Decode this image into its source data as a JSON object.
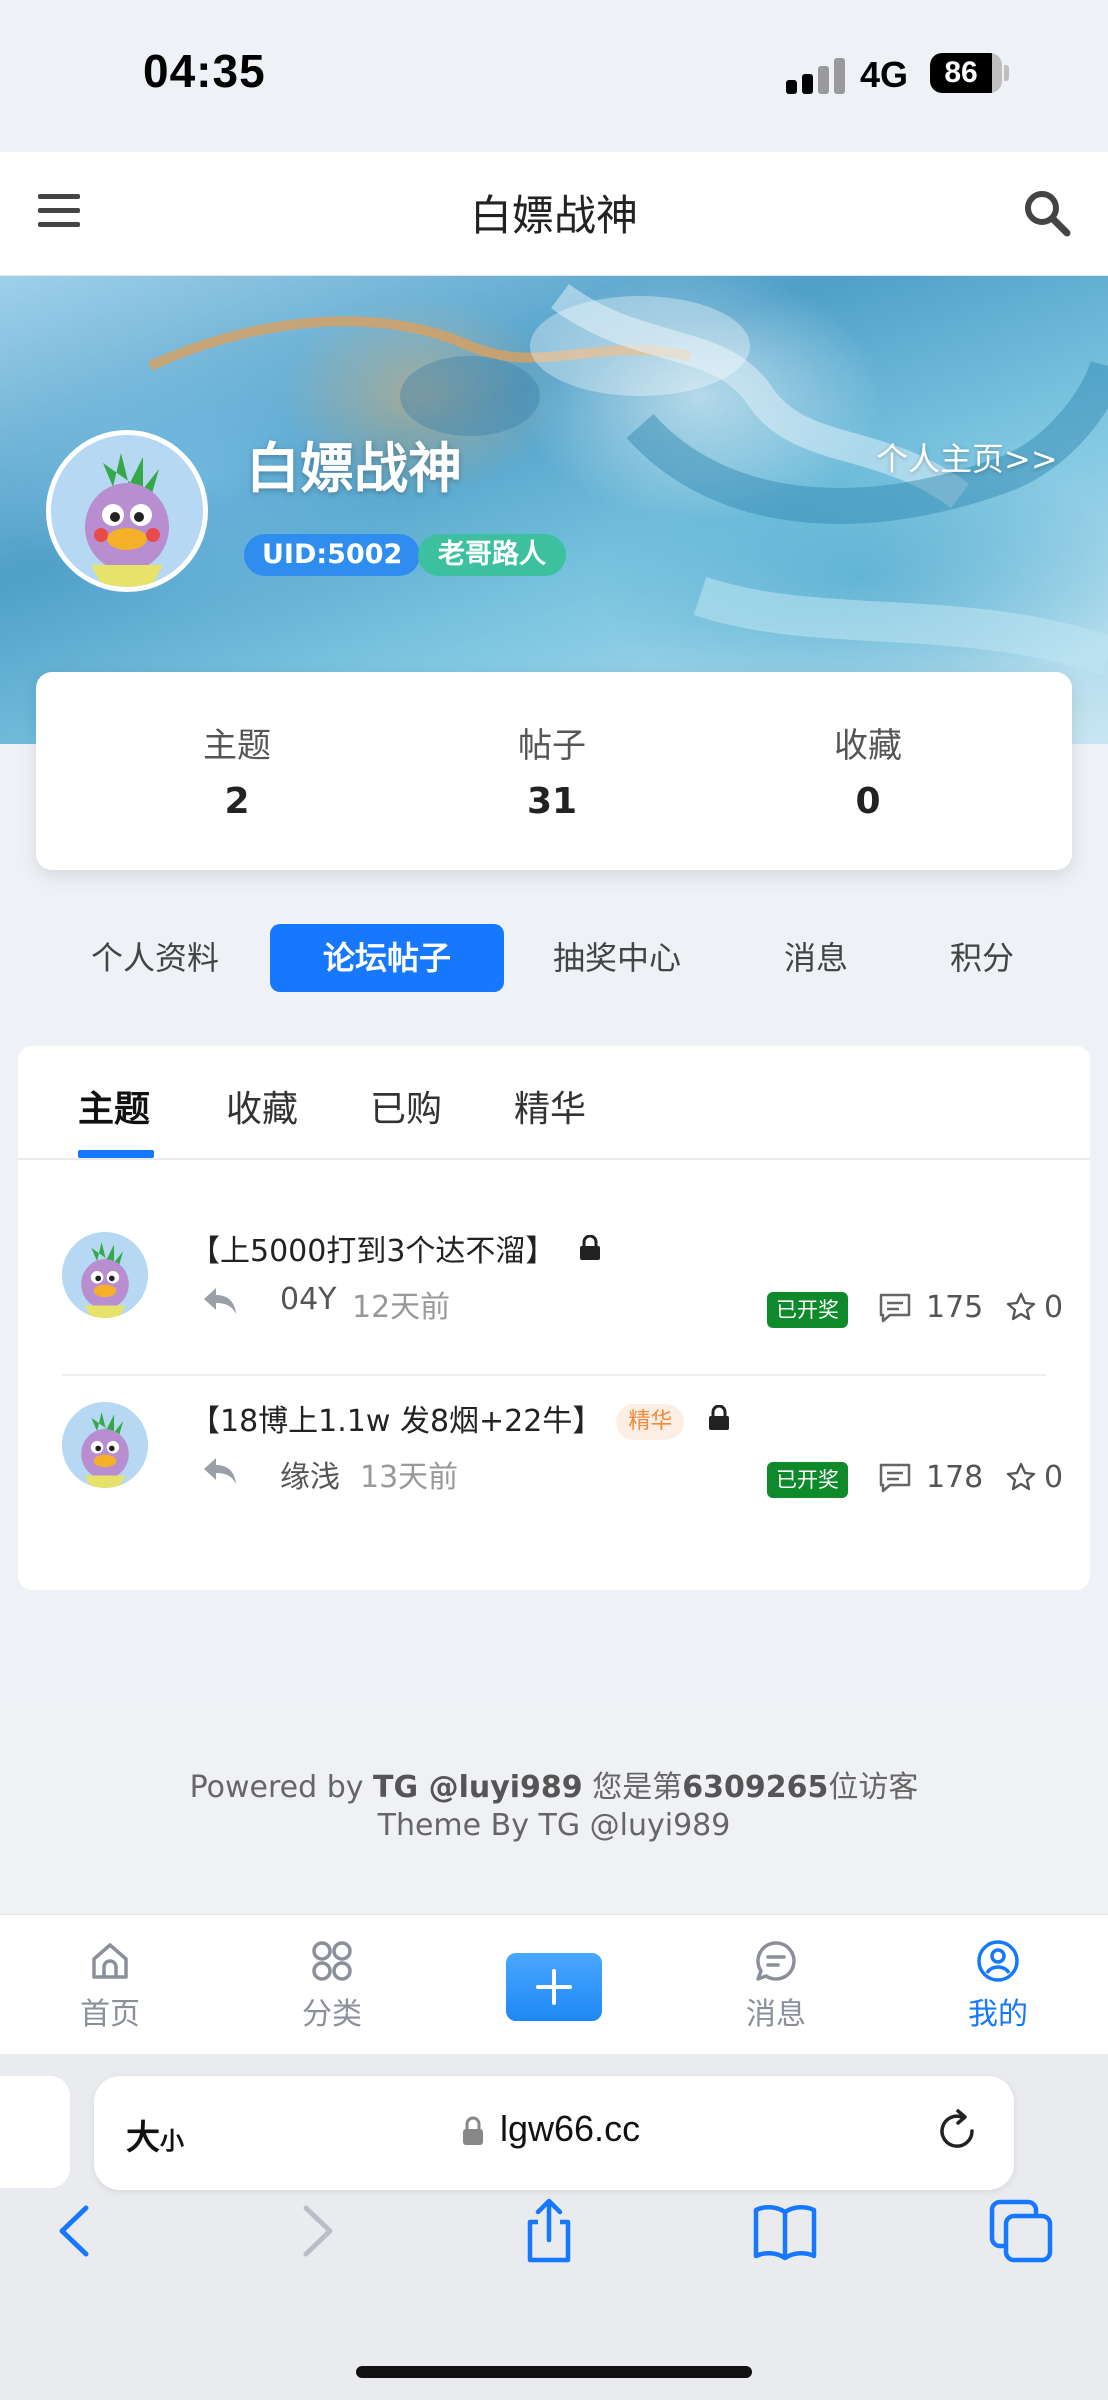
{
  "status_bar": {
    "time": "04:35",
    "network": "4G",
    "battery": "86",
    "battery_level": 0.86
  },
  "header": {
    "title": "白嫖战神"
  },
  "profile": {
    "name": "白嫖战神",
    "homepage_link": "个人主页>>",
    "uid": "UID:5002",
    "rank": "老哥路人"
  },
  "stats": [
    {
      "label": "主题",
      "value": "2"
    },
    {
      "label": "帖子",
      "value": "31"
    },
    {
      "label": "收藏",
      "value": "0"
    }
  ],
  "main_tabs": [
    "个人资料",
    "论坛帖子",
    "抽奖中心",
    "消息",
    "积分"
  ],
  "sub_tabs": [
    "主题",
    "收藏",
    "已购",
    "精华"
  ],
  "posts": [
    {
      "title": "【上5000打到3个达不溜】",
      "tag": "",
      "user": "04Y",
      "time": "12天前",
      "prize": "已开奖",
      "comments": "175",
      "stars": "0"
    },
    {
      "title": "【18博上1.1w 发8烟+22牛】",
      "tag": "精华",
      "user": "缘浅",
      "time": "13天前",
      "prize": "已开奖",
      "comments": "178",
      "stars": "0"
    }
  ],
  "footer": {
    "powered_prefix": "Powered by ",
    "powered_by": "TG @luyi989",
    "visitor_prefix": " 您是第",
    "visitor_count": "6309265",
    "visitor_suffix": "位访客",
    "theme": "Theme By TG @luyi989"
  },
  "bottom_nav": [
    {
      "label": "首页",
      "icon": "home-icon"
    },
    {
      "label": "分类",
      "icon": "grid-icon"
    },
    {
      "label": "",
      "icon": "plus-icon"
    },
    {
      "label": "消息",
      "icon": "chat-icon"
    },
    {
      "label": "我的",
      "icon": "user-circle-icon"
    }
  ],
  "browser": {
    "aa_big": "大",
    "aa_small": "小",
    "url": "lgw66.cc"
  },
  "colors": {
    "accent": "#1677ff",
    "uid_badge": "#2f8df0",
    "rank_badge": "#3cc0a0",
    "prize_badge": "#0f8a2a",
    "jinghua_tag": "#f08a3c"
  }
}
